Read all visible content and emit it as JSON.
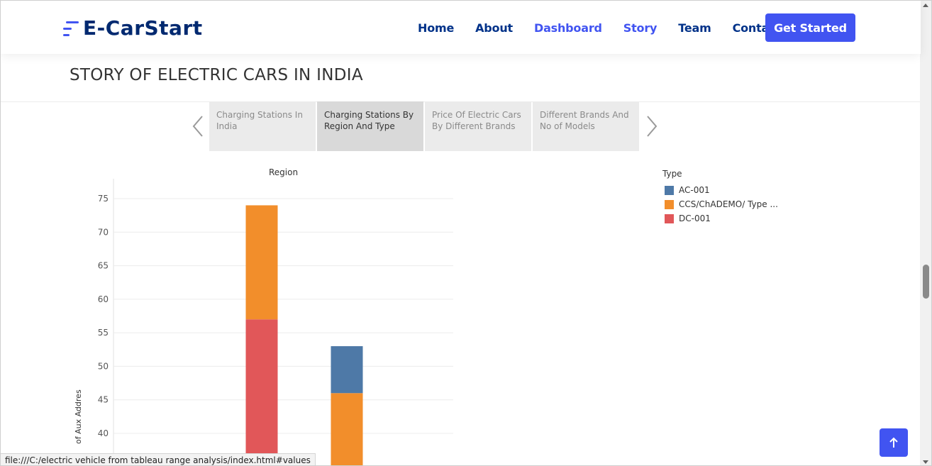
{
  "header": {
    "logo_text": "E-CarStart",
    "nav": [
      "Home",
      "About",
      "Dashboard",
      "Story",
      "Team",
      "Contact"
    ],
    "cta_label": "Get Started"
  },
  "page": {
    "title": "STORY OF ELECTRIC CARS IN INDIA"
  },
  "story": {
    "tabs": [
      {
        "label": "Charging Stations In India",
        "active": false
      },
      {
        "label": "Charging Stations By Region And Type",
        "active": true
      },
      {
        "label": "Price Of Electric Cars By Different Brands",
        "active": false
      },
      {
        "label": "Different Brands And No of Models",
        "active": false
      }
    ],
    "prev_icon": "chevron-left-icon",
    "next_icon": "chevron-right-icon"
  },
  "chart_data": {
    "type": "bar",
    "stacked": true,
    "title": "",
    "column_header": "Region",
    "ylabel": "of Aux Addres",
    "ylim": [
      37,
      77
    ],
    "yticks": [
      40,
      45,
      50,
      55,
      60,
      65,
      70,
      75
    ],
    "grid": true,
    "legend_title": "Type",
    "legend_position": "right",
    "categories": [
      "",
      "",
      ""
    ],
    "series": [
      {
        "name": "DC-001",
        "color": "#e15759",
        "values": [
          0,
          57,
          0
        ]
      },
      {
        "name": "CCS/ChADEMO/ Type ...",
        "color": "#f28e2b",
        "values": [
          0,
          17,
          46
        ]
      },
      {
        "name": "AC-001",
        "color": "#4e79a7",
        "values": [
          0,
          0,
          7
        ]
      }
    ]
  },
  "status_bar": {
    "text": "file:///C:/electric vehicle from tableau range analysis/index.html#values"
  },
  "colors": {
    "brand": "#4154f1",
    "nav_text": "#013289"
  },
  "icons": {
    "back_to_top": "arrow-up-icon"
  }
}
